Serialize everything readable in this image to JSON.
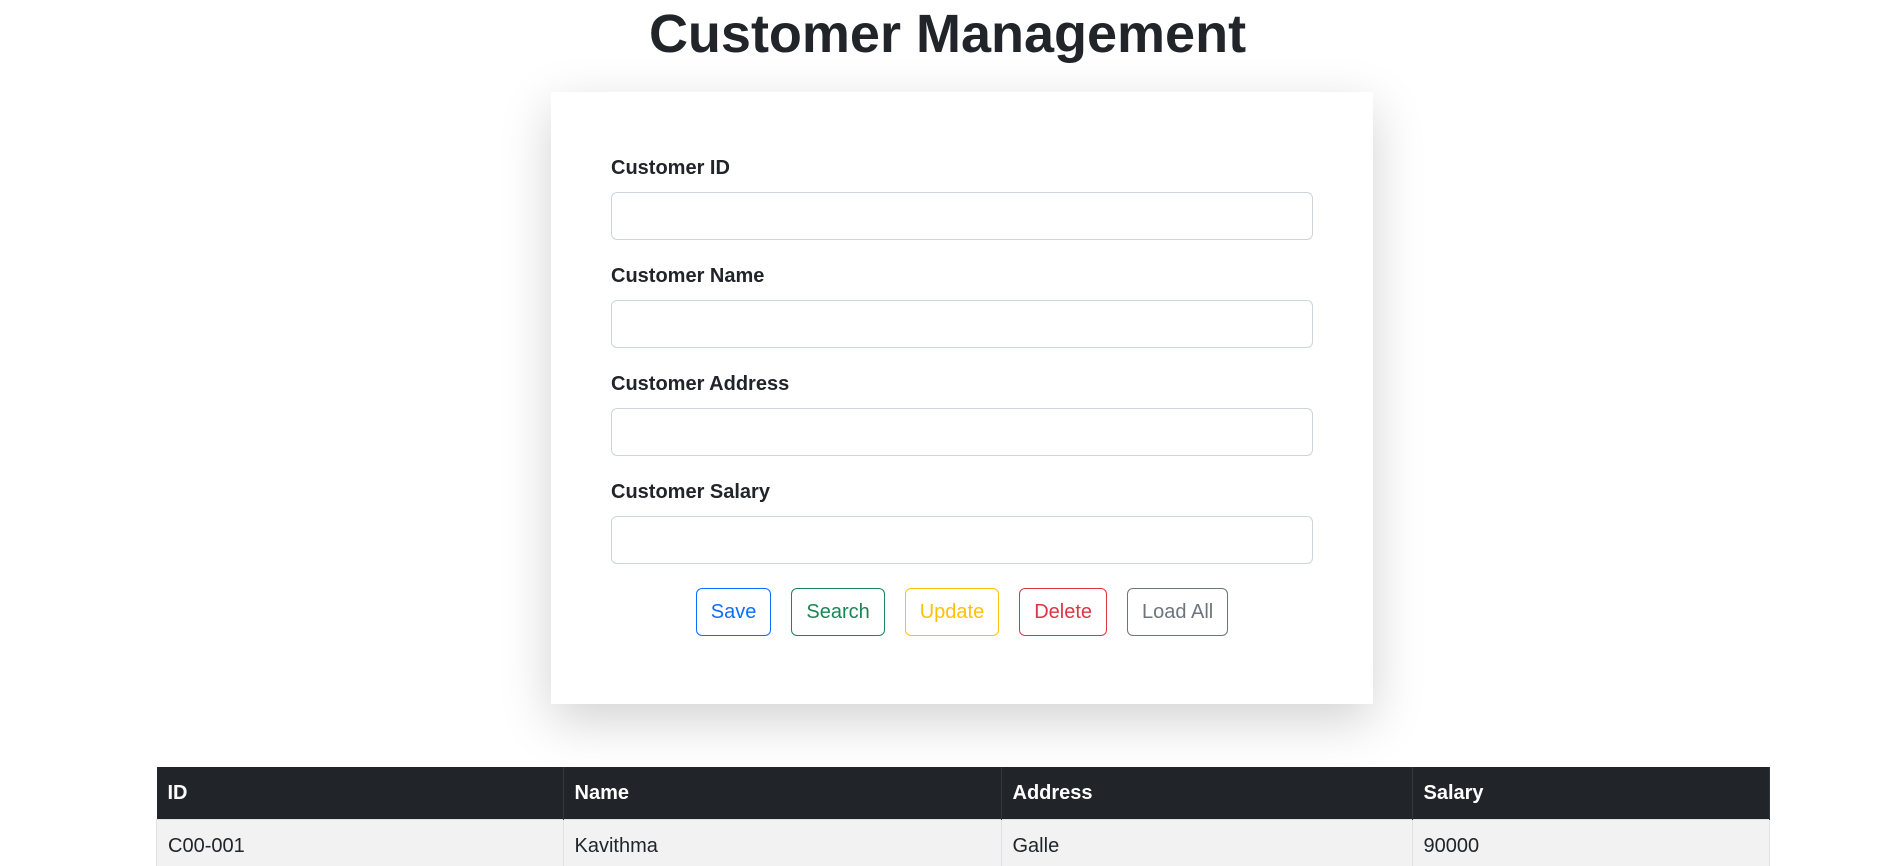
{
  "page": {
    "title": "Customer Management"
  },
  "form": {
    "fields": [
      {
        "label": "Customer ID",
        "value": "",
        "placeholder": ""
      },
      {
        "label": "Customer Name",
        "value": "",
        "placeholder": ""
      },
      {
        "label": "Customer Address",
        "value": "",
        "placeholder": ""
      },
      {
        "label": "Customer Salary",
        "value": "",
        "placeholder": ""
      }
    ],
    "buttons": {
      "save": "Save",
      "search": "Search",
      "update": "Update",
      "delete": "Delete",
      "load_all": "Load All"
    }
  },
  "table": {
    "headers": [
      "ID",
      "Name",
      "Address",
      "Salary"
    ],
    "rows": [
      [
        "C00-001",
        "Kavithma",
        "Galle",
        "90000"
      ]
    ]
  },
  "colors": {
    "primary": "#0d6efd",
    "success": "#198754",
    "warning": "#ffc107",
    "danger": "#dc3545",
    "secondary": "#6c757d",
    "table_header_bg": "#212529"
  }
}
